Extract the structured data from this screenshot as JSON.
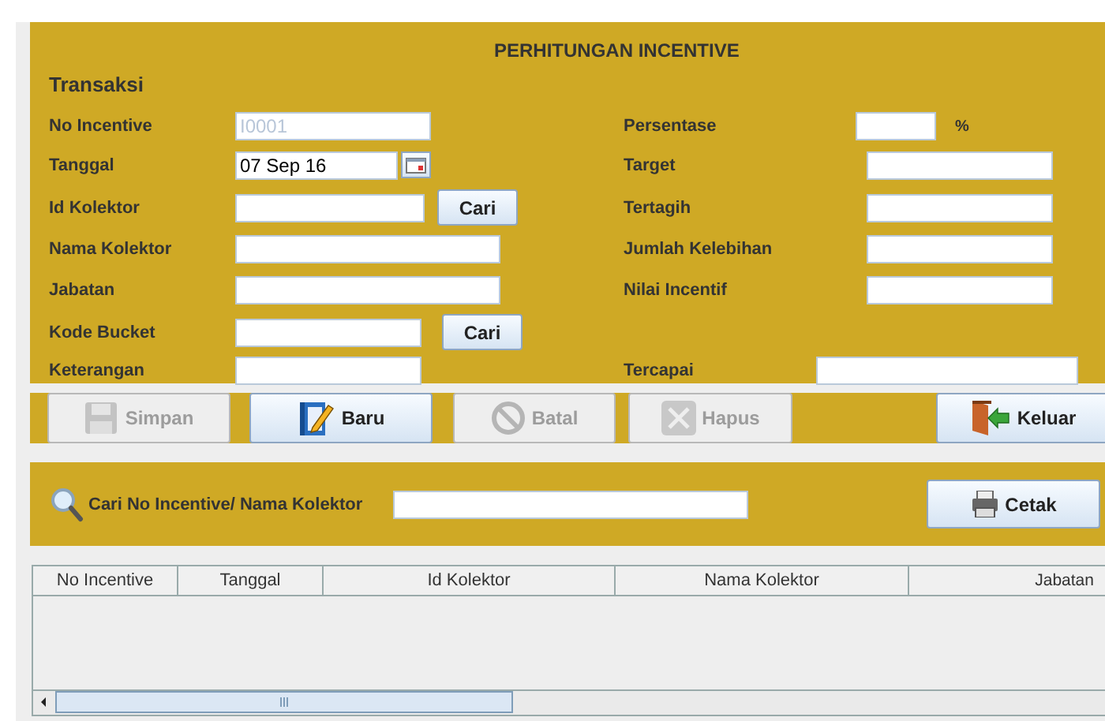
{
  "title": "PERHITUNGAN INCENTIVE",
  "section": "Transaksi",
  "left_fields": [
    {
      "label": "No Incentive",
      "kind": "text",
      "value": "I0001",
      "editable": false
    },
    {
      "label": "Tanggal",
      "kind": "date",
      "value": "07 Sep 16",
      "editable": true
    },
    {
      "label": "Id Kolektor",
      "kind": "lookup",
      "button": "Cari"
    },
    {
      "label": "Nama Kolektor",
      "kind": "text"
    },
    {
      "label": "Jabatan",
      "kind": "text"
    },
    {
      "label": "Kode Bucket",
      "kind": "lookup",
      "button": "Cari"
    },
    {
      "label": "Keterangan",
      "kind": "text"
    }
  ],
  "right_fields": [
    {
      "label": "Persentase",
      "unit": "%"
    },
    {
      "label": "Target"
    },
    {
      "label": "Tertagih"
    },
    {
      "label": "Jumlah Kelebihan"
    },
    {
      "label": "Nilai Incentif"
    },
    {
      "label": "Tercapai"
    }
  ],
  "actions": [
    {
      "label": "Simpan",
      "kind": "save",
      "disabled": true
    },
    {
      "label": "Baru",
      "kind": "new",
      "disabled": false
    },
    {
      "label": "Batal",
      "kind": "cancel",
      "disabled": true
    },
    {
      "label": "Hapus",
      "kind": "delete",
      "disabled": true
    },
    {
      "label": "Keluar",
      "kind": "exit",
      "disabled": false
    }
  ],
  "search": {
    "label": "Cari No Incentive/ Nama Kolektor",
    "button": "Cetak"
  },
  "table": {
    "columns": [
      "No Incentive",
      "Tanggal",
      "Id Kolektor",
      "Nama Kolektor",
      "Jabatan"
    ]
  }
}
